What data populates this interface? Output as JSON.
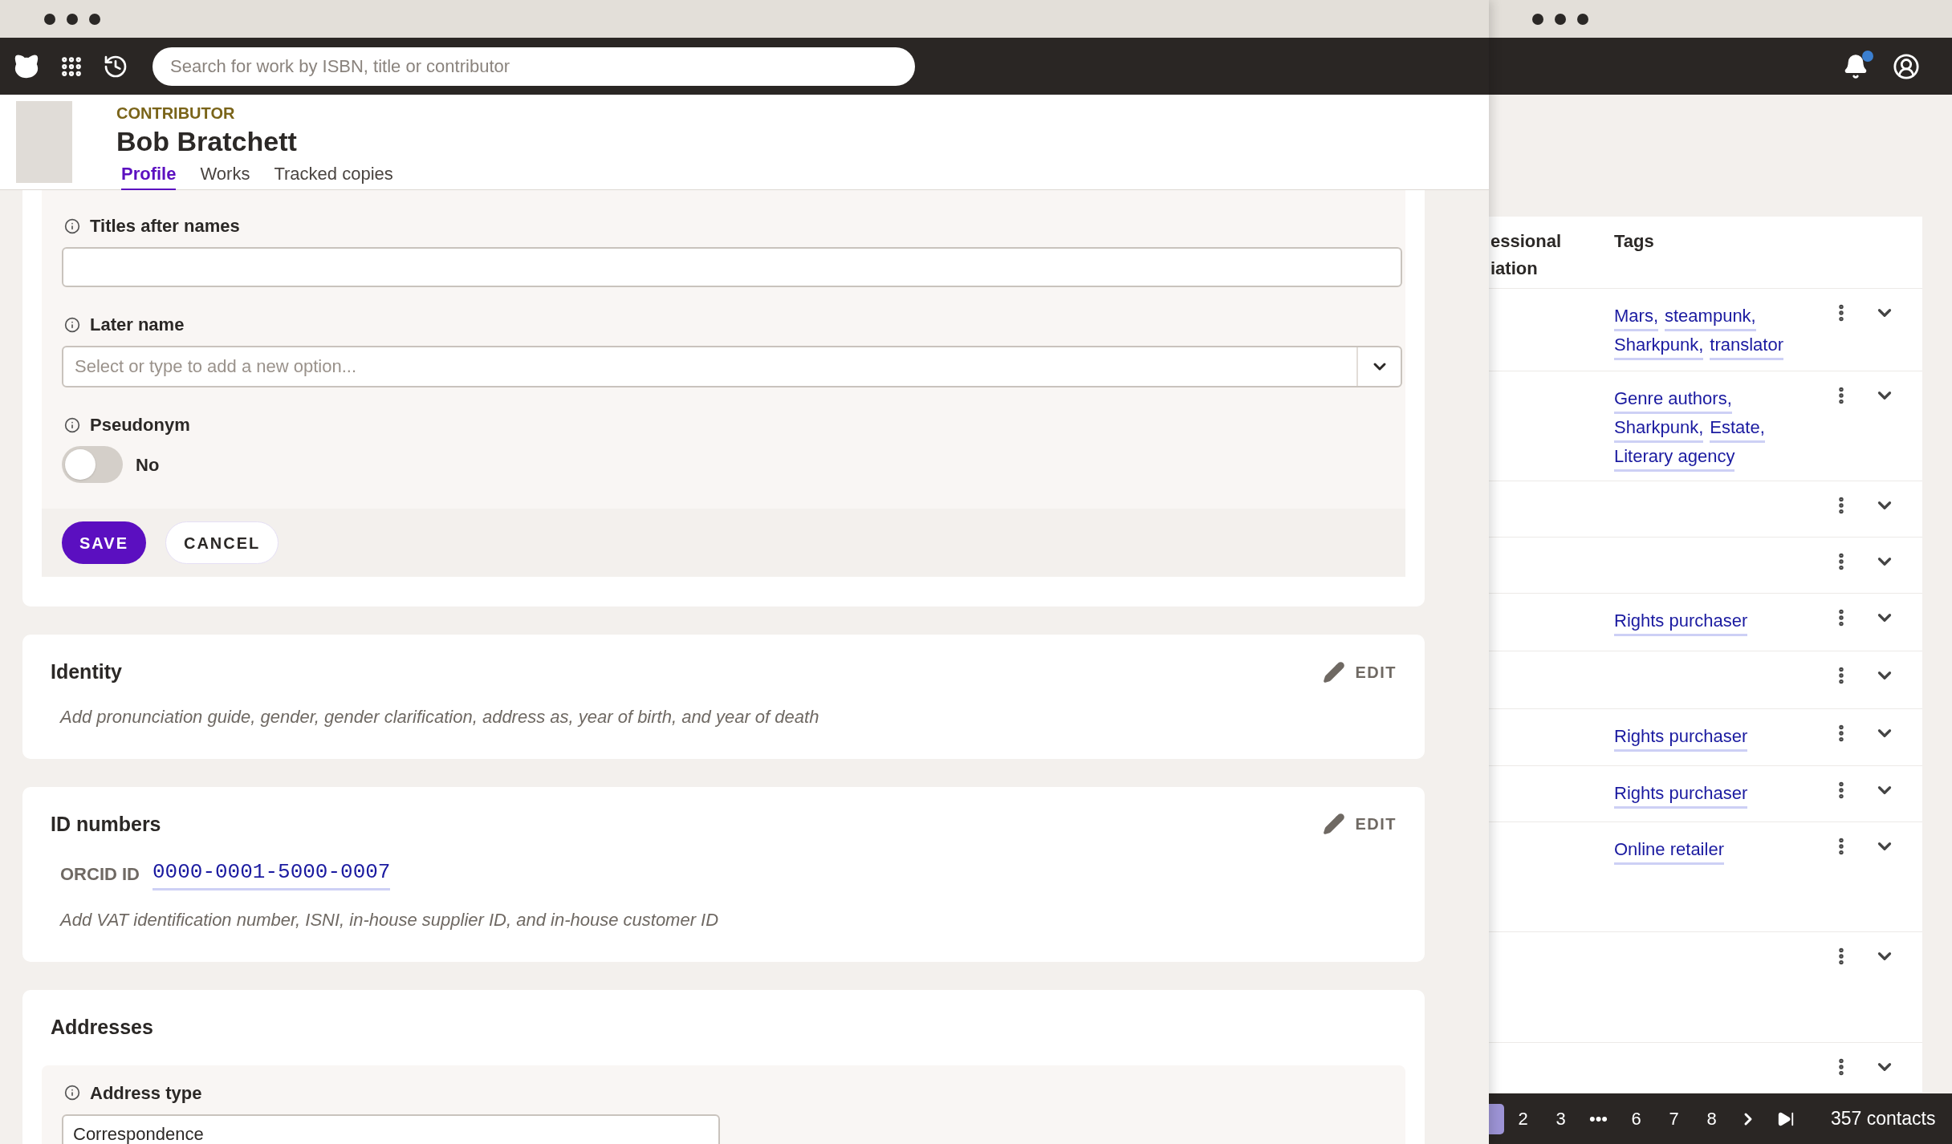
{
  "back_window": {
    "notifications": {
      "has_unread": true
    },
    "table": {
      "columns": [
        "essional iation",
        "Tags"
      ],
      "rows": [
        {
          "tags": [
            "Mars,",
            "steampunk,",
            "Sharkpunk,",
            "translator"
          ]
        },
        {
          "tags": [
            "Genre authors,",
            "Sharkpunk,",
            "Estate,",
            "Literary agency"
          ]
        },
        {
          "tags": []
        },
        {
          "tags": []
        },
        {
          "tags": [
            "Rights purchaser"
          ]
        },
        {
          "tags": []
        },
        {
          "tags": [
            "Rights purchaser"
          ]
        },
        {
          "tags": [
            "Rights purchaser"
          ]
        },
        {
          "tags": [
            "Online retailer"
          ]
        },
        {
          "tags": []
        },
        {
          "tags": []
        }
      ]
    },
    "pagination": {
      "pages": [
        {
          "label": "2",
          "selected": false
        },
        {
          "label": "3",
          "selected": false
        },
        {
          "label": "•••",
          "selected": false
        },
        {
          "label": "6",
          "selected": false
        },
        {
          "label": "7",
          "selected": false
        },
        {
          "label": "8",
          "selected": false
        }
      ],
      "total": "357 contacts"
    }
  },
  "front_window": {
    "search": {
      "placeholder": "Search for work by ISBN, title or contributor"
    },
    "header": {
      "kind_label": "CONTRIBUTOR",
      "name": "Bob Bratchett",
      "tabs": [
        {
          "label": "Profile",
          "selected": true
        },
        {
          "label": "Works",
          "selected": false
        },
        {
          "label": "Tracked copies",
          "selected": false
        }
      ]
    },
    "form": {
      "fields": [
        {
          "kind": "text",
          "label": "Titles after names"
        },
        {
          "kind": "select",
          "label": "Later name",
          "placeholder": "Select or type to add a new option..."
        },
        {
          "kind": "toggle",
          "label": "Pseudonym",
          "on": false,
          "state_label": "No"
        }
      ],
      "buttons": [
        {
          "kind": "primary",
          "label": "SAVE"
        },
        {
          "kind": "secondary",
          "label": "CANCEL"
        }
      ]
    },
    "sections": [
      {
        "title": "Identity",
        "edit": "EDIT",
        "hint": "Add pronunciation guide, gender, gender clarification, address as, year of birth, and year of death"
      },
      {
        "title": "ID numbers",
        "edit": "EDIT",
        "ids": [
          {
            "label": "ORCID ID",
            "value": "0000-0001-5000-0007"
          }
        ],
        "hint": "Add VAT identification number, ISNI, in-house supplier ID, and in-house customer ID"
      },
      {
        "title": "Addresses",
        "fields": [
          {
            "kind": "text",
            "label": "Address type",
            "value": "Correspondence"
          }
        ]
      }
    ]
  }
}
